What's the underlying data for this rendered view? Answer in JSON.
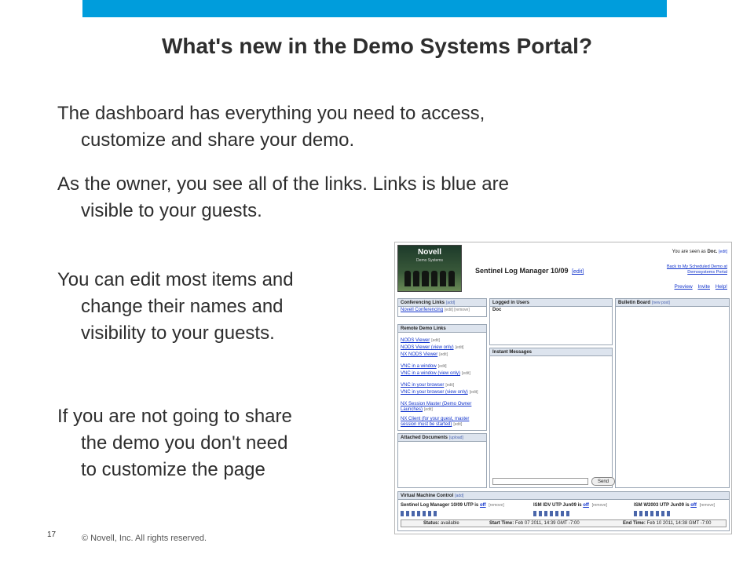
{
  "slide": {
    "title": "What's new in the Demo Systems Portal?",
    "bullets": [
      {
        "line1": "The dashboard has everything you need to access,",
        "line2": "customize and share your demo."
      },
      {
        "line1": "As the owner, you see all of the links.  Links is blue are",
        "line2": "visible to your guests."
      },
      {
        "line1": "You can edit most items and",
        "line2": "change their names and",
        "line3": "visibility to your guests."
      },
      {
        "line1": "If you are not going to share",
        "line2": "the demo you don't need",
        "line3": "to customize the page"
      }
    ],
    "page_number": "17",
    "copyright": "© Novell, Inc.  All rights reserved.",
    "accent_color": "#009ddc"
  },
  "screenshot": {
    "logo_brand": "Novell",
    "logo_sub": "Demo Systems",
    "demo_name": "Sentinel Log Manager 10/09",
    "edit_label": "[edit]",
    "seen_prefix": "You are seen as",
    "seen_name": "Doc.",
    "back_link": "Back to My Scheduled Demo at Demosystems Portal",
    "header_links": [
      "Preview",
      "Invite",
      "Help!"
    ],
    "conferencing": {
      "title": "Conferencing Links",
      "tag": "[add]",
      "items": [
        {
          "label": "Novell Conferencing",
          "tag": "[edit] [remove]"
        }
      ]
    },
    "remote": {
      "title": "Remote Demo Links",
      "items": [
        {
          "label": "NODS Viewer",
          "tag": "[edit]"
        },
        {
          "label": "NODS Viewer (view only)",
          "tag": "[edit]"
        },
        {
          "label": "NX NODS Viewer",
          "tag": "[edit]"
        },
        {
          "label": "VNC in a window",
          "tag": "[edit]"
        },
        {
          "label": "VNC in a window (view only)",
          "tag": "[edit]"
        },
        {
          "label": "VNC in your browser",
          "tag": "[edit]"
        },
        {
          "label": "VNC in your browser (view only)",
          "tag": "[edit]"
        },
        {
          "label": "NX Session Master (Demo Owner Launches)",
          "tag": "[edit]"
        },
        {
          "label": "NX Client (for your guest, master session must be started)",
          "tag": "[edit]"
        }
      ]
    },
    "attached": {
      "title": "Attached Documents",
      "tag": "[upload]"
    },
    "logged_in": {
      "title": "Logged in Users",
      "users": [
        "Doc"
      ]
    },
    "instant": {
      "title": "Instant Messages",
      "send_label": "Send"
    },
    "bulletin": {
      "title": "Bulletin Board",
      "tag": "[new post]"
    },
    "vm": {
      "title": "Virtual Machine Control",
      "tag": "[add]",
      "machines": [
        {
          "name": "Sentinel Log Manager 10/09 UTP is",
          "state": "off",
          "tag": "[remove]"
        },
        {
          "name": "ISM IDV UTP Jun09 is",
          "state": "off",
          "tag": "[remove]"
        },
        {
          "name": "ISM W2003 UTP Jun09 is",
          "state": "off",
          "tag": "[remove]"
        }
      ]
    },
    "status": {
      "status_label": "Status:",
      "status_value": "available",
      "start_label": "Start Time:",
      "start_value": "Feb 07 2011, 14:39 GMT -7:00",
      "end_label": "End Time:",
      "end_value": "Feb 10 2011, 14:38 GMT -7:00"
    }
  }
}
